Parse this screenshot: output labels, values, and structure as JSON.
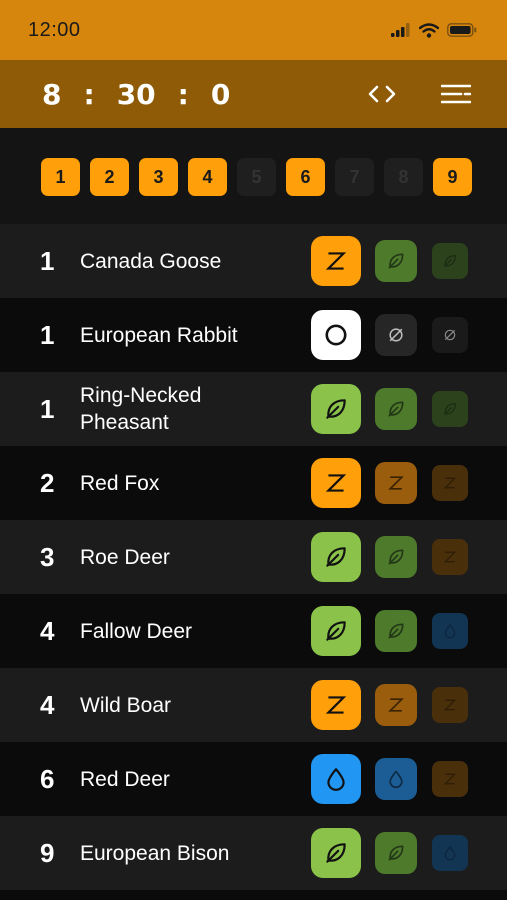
{
  "status_bar": {
    "time": "12:00"
  },
  "timer": {
    "hours": "8",
    "minutes": "30",
    "seconds": "0",
    "separator": ":"
  },
  "days": [
    {
      "label": "1",
      "active": true
    },
    {
      "label": "2",
      "active": true
    },
    {
      "label": "3",
      "active": true
    },
    {
      "label": "4",
      "active": true
    },
    {
      "label": "5",
      "active": false
    },
    {
      "label": "6",
      "active": true
    },
    {
      "label": "7",
      "active": false
    },
    {
      "label": "8",
      "active": false
    },
    {
      "label": "9",
      "active": true
    }
  ],
  "colors": {
    "orange_bright": "#ff9f0a",
    "orange_mid": "#9a5d0d",
    "orange_dim": "#4a2f0b",
    "green_bright": "#8bc34a",
    "green_mid": "#4e7a2c",
    "green_dim": "#2c421c",
    "blue_bright": "#2196f3",
    "blue_mid": "#1c5d95",
    "blue_dim": "#133554",
    "white": "#ffffff",
    "dark_mid": "#262626",
    "dark_dim": "#1a1a1a"
  },
  "animals": [
    {
      "day": "1",
      "name": "Canada Goose",
      "status": [
        "sleep-bright",
        "leaf-mid",
        "leaf-dim"
      ]
    },
    {
      "day": "1",
      "name": "European Rabbit",
      "status": [
        "circle-white",
        "none-dark-mid",
        "none-dark-dim"
      ]
    },
    {
      "day": "1",
      "name": "Ring-Necked Pheasant",
      "status": [
        "leaf-bright",
        "leaf-mid",
        "leaf-dim"
      ]
    },
    {
      "day": "2",
      "name": "Red Fox",
      "status": [
        "sleep-bright",
        "sleep-mid",
        "sleep-dim"
      ]
    },
    {
      "day": "3",
      "name": "Roe Deer",
      "status": [
        "leaf-bright",
        "leaf-mid",
        "sleep-dim"
      ]
    },
    {
      "day": "4",
      "name": "Fallow Deer",
      "status": [
        "leaf-bright",
        "leaf-mid",
        "drop-dim"
      ]
    },
    {
      "day": "4",
      "name": "Wild Boar",
      "status": [
        "sleep-bright",
        "sleep-mid",
        "sleep-dim"
      ]
    },
    {
      "day": "6",
      "name": "Red Deer",
      "status": [
        "drop-bright",
        "drop-mid",
        "sleep-dim"
      ]
    },
    {
      "day": "9",
      "name": "European Bison",
      "status": [
        "leaf-bright",
        "leaf-mid",
        "drop-dim"
      ]
    }
  ]
}
